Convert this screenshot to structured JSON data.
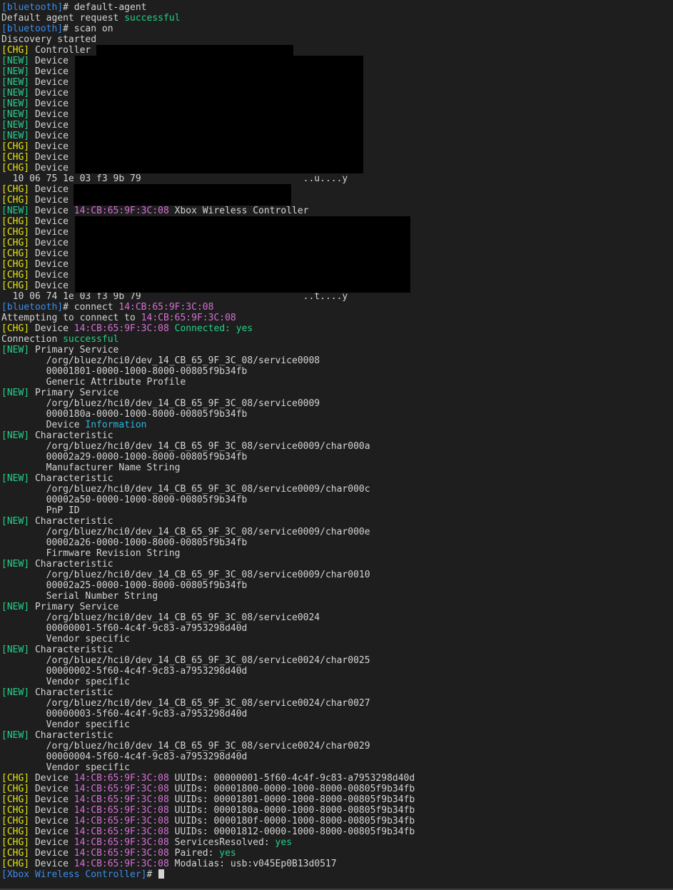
{
  "colors": {
    "background": "#1e1e1e",
    "text": "#d4d4d4",
    "prompt": "#3b8eea",
    "new_tag": "#23d18b",
    "chg_tag": "#e5e510",
    "mac": "#d670d6",
    "success": "#23d18b",
    "information": "#29b8db",
    "redaction": "#000000"
  },
  "lines": [
    [
      {
        "t": "[bluetooth]",
        "c": "prompt"
      },
      {
        "t": "# default-agent"
      }
    ],
    [
      {
        "t": "Default agent request "
      },
      {
        "t": "successful",
        "c": "green"
      }
    ],
    [
      {
        "t": "[bluetooth]",
        "c": "prompt"
      },
      {
        "t": "# scan on"
      }
    ],
    [
      {
        "t": "Discovery started"
      }
    ],
    [
      {
        "t": "[CHG]",
        "c": "chg"
      },
      {
        "t": " Controller"
      }
    ],
    [
      {
        "t": "[NEW]",
        "c": "new"
      },
      {
        "t": " Device"
      }
    ],
    [
      {
        "t": "[NEW]",
        "c": "new"
      },
      {
        "t": " Device"
      }
    ],
    [
      {
        "t": "[NEW]",
        "c": "new"
      },
      {
        "t": " Device"
      }
    ],
    [
      {
        "t": "[NEW]",
        "c": "new"
      },
      {
        "t": " Device"
      }
    ],
    [
      {
        "t": "[NEW]",
        "c": "new"
      },
      {
        "t": " Device"
      }
    ],
    [
      {
        "t": "[NEW]",
        "c": "new"
      },
      {
        "t": " Device"
      }
    ],
    [
      {
        "t": "[NEW]",
        "c": "new"
      },
      {
        "t": " Device"
      }
    ],
    [
      {
        "t": "[NEW]",
        "c": "new"
      },
      {
        "t": " Device"
      }
    ],
    [
      {
        "t": "[CHG]",
        "c": "chg"
      },
      {
        "t": " Device"
      }
    ],
    [
      {
        "t": "[CHG]",
        "c": "chg"
      },
      {
        "t": " Device"
      }
    ],
    [
      {
        "t": "[CHG]",
        "c": "chg"
      },
      {
        "t": " Device"
      }
    ],
    [
      {
        "t": "  10 06 75 1e 03 f3 9b 79                             ..u....y"
      }
    ],
    [
      {
        "t": "[CHG]",
        "c": "chg"
      },
      {
        "t": " Device"
      }
    ],
    [
      {
        "t": "[CHG]",
        "c": "chg"
      },
      {
        "t": " Device"
      }
    ],
    [
      {
        "t": "[NEW]",
        "c": "new"
      },
      {
        "t": " Device "
      },
      {
        "t": "14:CB:65:9F:3C:08",
        "c": "mac"
      },
      {
        "t": " Xbox Wireless Controller"
      }
    ],
    [
      {
        "t": "[CHG]",
        "c": "chg"
      },
      {
        "t": " Device"
      }
    ],
    [
      {
        "t": "[CHG]",
        "c": "chg"
      },
      {
        "t": " Device"
      }
    ],
    [
      {
        "t": "[CHG]",
        "c": "chg"
      },
      {
        "t": " Device"
      }
    ],
    [
      {
        "t": "[CHG]",
        "c": "chg"
      },
      {
        "t": " Device"
      }
    ],
    [
      {
        "t": "[CHG]",
        "c": "chg"
      },
      {
        "t": " Device"
      }
    ],
    [
      {
        "t": "[CHG]",
        "c": "chg"
      },
      {
        "t": " Device"
      }
    ],
    [
      {
        "t": "[CHG]",
        "c": "chg"
      },
      {
        "t": " Device"
      }
    ],
    [
      {
        "t": "  10 06 74 1e 03 f3 9b 79                             ..t....y"
      }
    ],
    [
      {
        "t": "[bluetooth]",
        "c": "prompt"
      },
      {
        "t": "# connect "
      },
      {
        "t": "14:CB:65:9F:3C:08",
        "c": "mac"
      }
    ],
    [
      {
        "t": "Attempting to connect to "
      },
      {
        "t": "14:CB:65:9F:3C:08",
        "c": "mac"
      }
    ],
    [
      {
        "t": "[CHG]",
        "c": "chg"
      },
      {
        "t": " Device "
      },
      {
        "t": "14:CB:65:9F:3C:08",
        "c": "mac"
      },
      {
        "t": " "
      },
      {
        "t": "Connected:",
        "c": "green"
      },
      {
        "t": " "
      },
      {
        "t": "yes",
        "c": "green"
      }
    ],
    [
      {
        "t": "Connection "
      },
      {
        "t": "successful",
        "c": "green"
      }
    ],
    [
      {
        "t": "[NEW]",
        "c": "new"
      },
      {
        "t": " Primary Service"
      }
    ],
    [
      {
        "t": "        /org/bluez/hci0/dev_14_CB_65_9F_3C_08/service0008"
      }
    ],
    [
      {
        "t": "        00001801-0000-1000-8000-00805f9b34fb"
      }
    ],
    [
      {
        "t": "        Generic Attribute Profile"
      }
    ],
    [
      {
        "t": "[NEW]",
        "c": "new"
      },
      {
        "t": " Primary Service"
      }
    ],
    [
      {
        "t": "        /org/bluez/hci0/dev_14_CB_65_9F_3C_08/service0009"
      }
    ],
    [
      {
        "t": "        0000180a-0000-1000-8000-00805f9b34fb"
      }
    ],
    [
      {
        "t": "        Device "
      },
      {
        "t": "Information",
        "c": "info"
      }
    ],
    [
      {
        "t": "[NEW]",
        "c": "new"
      },
      {
        "t": " Characteristic"
      }
    ],
    [
      {
        "t": "        /org/bluez/hci0/dev_14_CB_65_9F_3C_08/service0009/char000a"
      }
    ],
    [
      {
        "t": "        00002a29-0000-1000-8000-00805f9b34fb"
      }
    ],
    [
      {
        "t": "        Manufacturer Name String"
      }
    ],
    [
      {
        "t": "[NEW]",
        "c": "new"
      },
      {
        "t": " Characteristic"
      }
    ],
    [
      {
        "t": "        /org/bluez/hci0/dev_14_CB_65_9F_3C_08/service0009/char000c"
      }
    ],
    [
      {
        "t": "        00002a50-0000-1000-8000-00805f9b34fb"
      }
    ],
    [
      {
        "t": "        PnP ID"
      }
    ],
    [
      {
        "t": "[NEW]",
        "c": "new"
      },
      {
        "t": " Characteristic"
      }
    ],
    [
      {
        "t": "        /org/bluez/hci0/dev_14_CB_65_9F_3C_08/service0009/char000e"
      }
    ],
    [
      {
        "t": "        00002a26-0000-1000-8000-00805f9b34fb"
      }
    ],
    [
      {
        "t": "        Firmware Revision String"
      }
    ],
    [
      {
        "t": "[NEW]",
        "c": "new"
      },
      {
        "t": " Characteristic"
      }
    ],
    [
      {
        "t": "        /org/bluez/hci0/dev_14_CB_65_9F_3C_08/service0009/char0010"
      }
    ],
    [
      {
        "t": "        00002a25-0000-1000-8000-00805f9b34fb"
      }
    ],
    [
      {
        "t": "        Serial Number String"
      }
    ],
    [
      {
        "t": "[NEW]",
        "c": "new"
      },
      {
        "t": " Primary Service"
      }
    ],
    [
      {
        "t": "        /org/bluez/hci0/dev_14_CB_65_9F_3C_08/service0024"
      }
    ],
    [
      {
        "t": "        00000001-5f60-4c4f-9c83-a7953298d40d"
      }
    ],
    [
      {
        "t": "        Vendor specific"
      }
    ],
    [
      {
        "t": "[NEW]",
        "c": "new"
      },
      {
        "t": " Characteristic"
      }
    ],
    [
      {
        "t": "        /org/bluez/hci0/dev_14_CB_65_9F_3C_08/service0024/char0025"
      }
    ],
    [
      {
        "t": "        00000002-5f60-4c4f-9c83-a7953298d40d"
      }
    ],
    [
      {
        "t": "        Vendor specific"
      }
    ],
    [
      {
        "t": "[NEW]",
        "c": "new"
      },
      {
        "t": " Characteristic"
      }
    ],
    [
      {
        "t": "        /org/bluez/hci0/dev_14_CB_65_9F_3C_08/service0024/char0027"
      }
    ],
    [
      {
        "t": "        00000003-5f60-4c4f-9c83-a7953298d40d"
      }
    ],
    [
      {
        "t": "        Vendor specific"
      }
    ],
    [
      {
        "t": "[NEW]",
        "c": "new"
      },
      {
        "t": " Characteristic"
      }
    ],
    [
      {
        "t": "        /org/bluez/hci0/dev_14_CB_65_9F_3C_08/service0024/char0029"
      }
    ],
    [
      {
        "t": "        00000004-5f60-4c4f-9c83-a7953298d40d"
      }
    ],
    [
      {
        "t": "        Vendor specific"
      }
    ],
    [
      {
        "t": "[CHG]",
        "c": "chg"
      },
      {
        "t": " Device "
      },
      {
        "t": "14:CB:65:9F:3C:08",
        "c": "mac"
      },
      {
        "t": " UUIDs: 00000001-5f60-4c4f-9c83-a7953298d40d"
      }
    ],
    [
      {
        "t": "[CHG]",
        "c": "chg"
      },
      {
        "t": " Device "
      },
      {
        "t": "14:CB:65:9F:3C:08",
        "c": "mac"
      },
      {
        "t": " UUIDs: 00001800-0000-1000-8000-00805f9b34fb"
      }
    ],
    [
      {
        "t": "[CHG]",
        "c": "chg"
      },
      {
        "t": " Device "
      },
      {
        "t": "14:CB:65:9F:3C:08",
        "c": "mac"
      },
      {
        "t": " UUIDs: 00001801-0000-1000-8000-00805f9b34fb"
      }
    ],
    [
      {
        "t": "[CHG]",
        "c": "chg"
      },
      {
        "t": " Device "
      },
      {
        "t": "14:CB:65:9F:3C:08",
        "c": "mac"
      },
      {
        "t": " UUIDs: 0000180a-0000-1000-8000-00805f9b34fb"
      }
    ],
    [
      {
        "t": "[CHG]",
        "c": "chg"
      },
      {
        "t": " Device "
      },
      {
        "t": "14:CB:65:9F:3C:08",
        "c": "mac"
      },
      {
        "t": " UUIDs: 0000180f-0000-1000-8000-00805f9b34fb"
      }
    ],
    [
      {
        "t": "[CHG]",
        "c": "chg"
      },
      {
        "t": " Device "
      },
      {
        "t": "14:CB:65:9F:3C:08",
        "c": "mac"
      },
      {
        "t": " UUIDs: 00001812-0000-1000-8000-00805f9b34fb"
      }
    ],
    [
      {
        "t": "[CHG]",
        "c": "chg"
      },
      {
        "t": " Device "
      },
      {
        "t": "14:CB:65:9F:3C:08",
        "c": "mac"
      },
      {
        "t": " ServicesResolved: "
      },
      {
        "t": "yes",
        "c": "green"
      }
    ],
    [
      {
        "t": "[CHG]",
        "c": "chg"
      },
      {
        "t": " Device "
      },
      {
        "t": "14:CB:65:9F:3C:08",
        "c": "mac"
      },
      {
        "t": " Paired: "
      },
      {
        "t": "yes",
        "c": "green"
      }
    ],
    [
      {
        "t": "[CHG]",
        "c": "chg"
      },
      {
        "t": " Device "
      },
      {
        "t": "14:CB:65:9F:3C:08",
        "c": "mac"
      },
      {
        "t": " Modalias: usb:v045Ep0B13d0517"
      }
    ],
    [
      {
        "t": "[Xbox Wireless Controller]",
        "c": "prompt"
      },
      {
        "t": "# "
      }
    ]
  ]
}
